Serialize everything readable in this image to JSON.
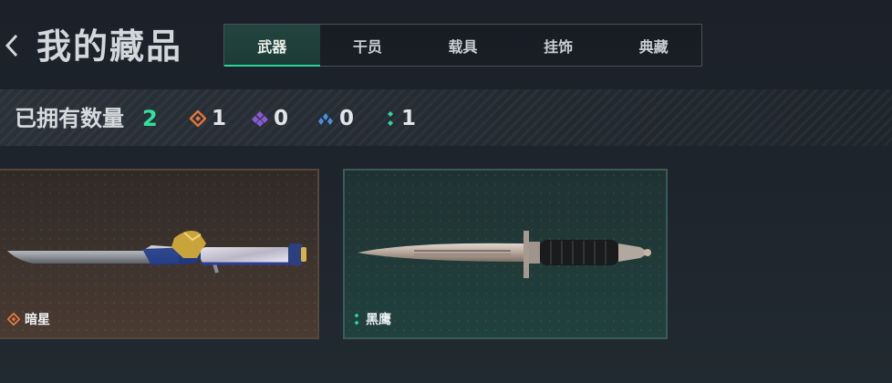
{
  "header": {
    "title": "我的藏品"
  },
  "tabs": [
    {
      "label": "武器",
      "active": true
    },
    {
      "label": "干员",
      "active": false
    },
    {
      "label": "载具",
      "active": false
    },
    {
      "label": "挂饰",
      "active": false
    },
    {
      "label": "典藏",
      "active": false
    }
  ],
  "stats": {
    "owned_label": "已拥有数量",
    "owned_count": "2",
    "rarities": [
      {
        "icon": "orange-diamond-icon",
        "color": "#e0773a",
        "count": "1"
      },
      {
        "icon": "purple-diamond-icon",
        "color": "#8a5ad6",
        "count": "0"
      },
      {
        "icon": "blue-triangle-icon",
        "color": "#4b8ee0",
        "count": "0"
      },
      {
        "icon": "green-dots-icon",
        "color": "#2ed79a",
        "count": "1"
      }
    ]
  },
  "items": [
    {
      "name": "暗星",
      "rarity_icon": "orange-diamond-icon"
    },
    {
      "name": "黑鹰",
      "rarity_icon": "green-dots-icon"
    }
  ],
  "colors": {
    "accent": "#27d59a",
    "owned_count": "#2fe39a"
  }
}
